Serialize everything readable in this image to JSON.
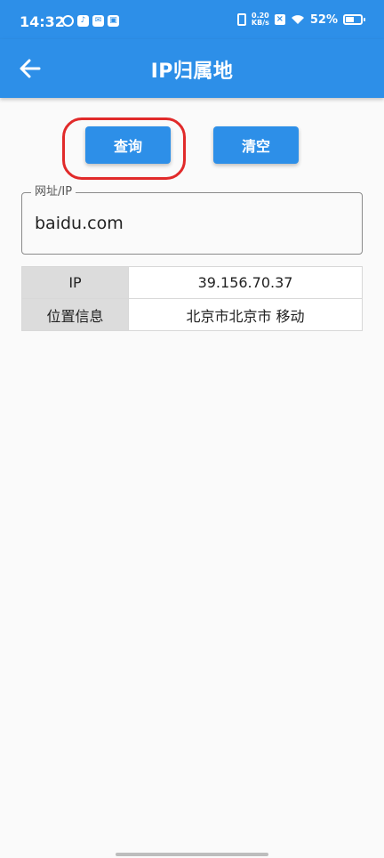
{
  "status_bar": {
    "time": "14:32",
    "net_speed_value": "0.20",
    "net_speed_unit": "KB/s",
    "battery": "52%"
  },
  "app_bar": {
    "title": "IP归属地"
  },
  "actions": {
    "query_label": "查询",
    "clear_label": "清空"
  },
  "input": {
    "label": "网址/IP",
    "value": "baidu.com"
  },
  "result": {
    "rows": [
      {
        "key": "IP",
        "value": "39.156.70.37"
      },
      {
        "key": "位置信息",
        "value": "北京市北京市 移动"
      }
    ]
  },
  "colors": {
    "primary": "#2d8fe8",
    "highlight": "#e12a2a"
  }
}
